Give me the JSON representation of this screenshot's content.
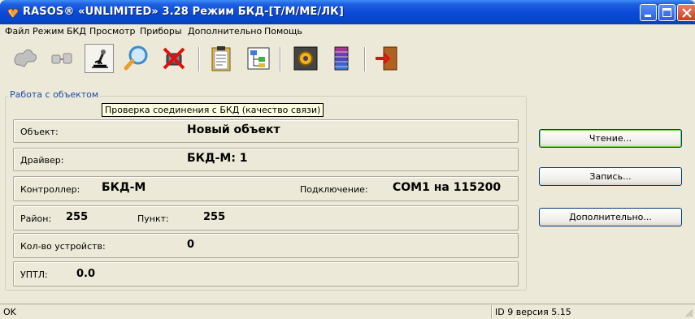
{
  "window": {
    "title": "RASOS® «UNLIMITED» 3.28 Режим БКД-[Т/М/МЕ/ЛК]"
  },
  "menu": [
    {
      "label": "Файл"
    },
    {
      "label": "Режим"
    },
    {
      "label": "БКД"
    },
    {
      "label": "Просмотр"
    },
    {
      "label": "Приборы"
    },
    {
      "label": "Дополнительно"
    },
    {
      "label": "Помощь"
    }
  ],
  "toolbar": {
    "icons": [
      "connect-icon",
      "plug-icon",
      "microscope-icon",
      "magnifier-icon",
      "disconnect-icon",
      "clipboard-icon",
      "tree-icon",
      "settings-panel-icon",
      "indicator-icon",
      "exit-door-icon"
    ]
  },
  "group": {
    "label": "Работа с объектом",
    "tooltip": "Проверка соединения с БКД (качество связи)"
  },
  "fields": {
    "object_label": "Объект:",
    "object_value": "Новый объект",
    "driver_label": "Драйвер:",
    "driver_value": "БКД-М: 1",
    "controller_label": "Контроллер:",
    "controller_value": "БКД-М",
    "connection_label": "Подключение:",
    "connection_value": "COM1 на 115200",
    "district_label": "Район:",
    "district_value": "255",
    "point_label": "Пункт:",
    "point_value": "255",
    "devices_label": "Кол-во устройств:",
    "devices_value": "0",
    "uptl_label": "УПТЛ:",
    "uptl_value": "0.0"
  },
  "buttons": {
    "read": "Чтение...",
    "write": "Запись...",
    "extra": "Дополнительно..."
  },
  "status": {
    "left": "OK",
    "right": "ID 9 версия 5.15"
  },
  "colors": {
    "titlebar": "#0a4ad8",
    "window_bg": "#ece9d8",
    "group_label": "#1e4ba6",
    "tooltip_bg": "#ffffe1"
  }
}
